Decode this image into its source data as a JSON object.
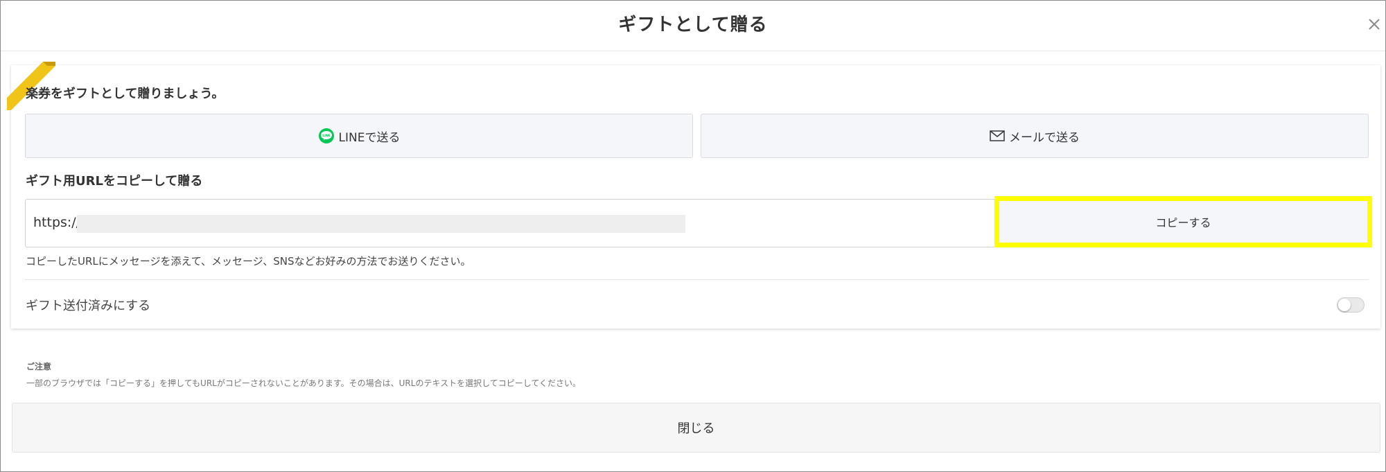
{
  "header": {
    "title": "ギフトとして贈る",
    "close_icon": "close-icon"
  },
  "card": {
    "heading": "楽券をギフトとして贈りましょう。",
    "share_buttons": [
      {
        "label": "LINEで送る",
        "icon": "line-icon",
        "icon_color": "#06c755"
      },
      {
        "label": "メールで送る",
        "icon": "mail-icon"
      }
    ],
    "url_section": {
      "label": "ギフト用URLをコピーして贈る",
      "url_prefix": "https://",
      "copy_label": "コピーする",
      "highlight_color": "#ffff00",
      "helper": "コピーしたURLにメッセージを添えて、メッセージ、SNSなどお好みの方法でお送りください。"
    },
    "sent_toggle": {
      "label": "ギフト送付済みにする",
      "on": false
    },
    "ribbon_color": "#f0c419"
  },
  "notes": {
    "title": "ご注意",
    "text": "一部のブラウザでは「コピーする」を押してもURLがコピーされないことがあります。その場合は、URLのテキストを選択してコピーしてください。"
  },
  "footer": {
    "close_label": "閉じる"
  }
}
